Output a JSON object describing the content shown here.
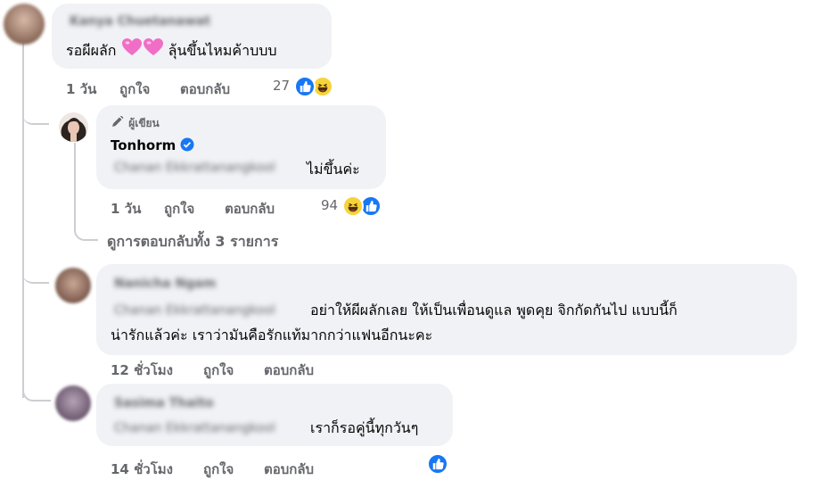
{
  "comment1": {
    "author_blurred": "Kanya Chuetanawat",
    "text_prefix": "รอผีผลัก",
    "text_suffix": "ลุ้นขึ้นไหมค้าบบบ",
    "time": "1 วัน",
    "like_label": "ถูกใจ",
    "reply_label": "ตอบกลับ",
    "reaction_count": "27",
    "emoji_icon": "two-hearts-icon"
  },
  "reply1": {
    "badge_label": "ผู้เขียน",
    "author": "Tonhorm",
    "tag_blurred": "Chanan Ekkrattanangkool",
    "text": "ไม่ขึ้นค่ะ",
    "time": "1 วัน",
    "like_label": "ถูกใจ",
    "reply_label": "ตอบกลับ",
    "reaction_count": "94"
  },
  "view_replies": "ดูการตอบกลับทั้ง 3 รายการ",
  "comment2": {
    "author_blurred": "Nanicha Ngam",
    "tag_blurred": "Chanan Ekkrattanangkool",
    "text_line1": "อย่าให้ผีผลักเลย ให้เป็นเพื่อนดูแล พูดคุย จิกกัดกันไป แบบนี้ก็",
    "text_line2": "น่ารักแล้วค่ะ เราว่ามันคือรักแท้มากกว่าแฟนอีกนะคะ",
    "time": "12 ชั่วโมง",
    "like_label": "ถูกใจ",
    "reply_label": "ตอบกลับ"
  },
  "comment3": {
    "author_blurred": "Sasima Thaito",
    "tag_blurred": "Chanan Ekkrattanangkool",
    "text": "เราก็รอคู่นี้ทุกวันๆ",
    "time": "14 ชั่วโมง",
    "like_label": "ถูกใจ",
    "reply_label": "ตอบกลับ"
  },
  "colors": {
    "bubble": "#f0f2f5",
    "secondary_text": "#65676b",
    "like_blue": "#1877f2",
    "verified_blue": "#1877f2",
    "heart_pink": "#f06ec6"
  }
}
